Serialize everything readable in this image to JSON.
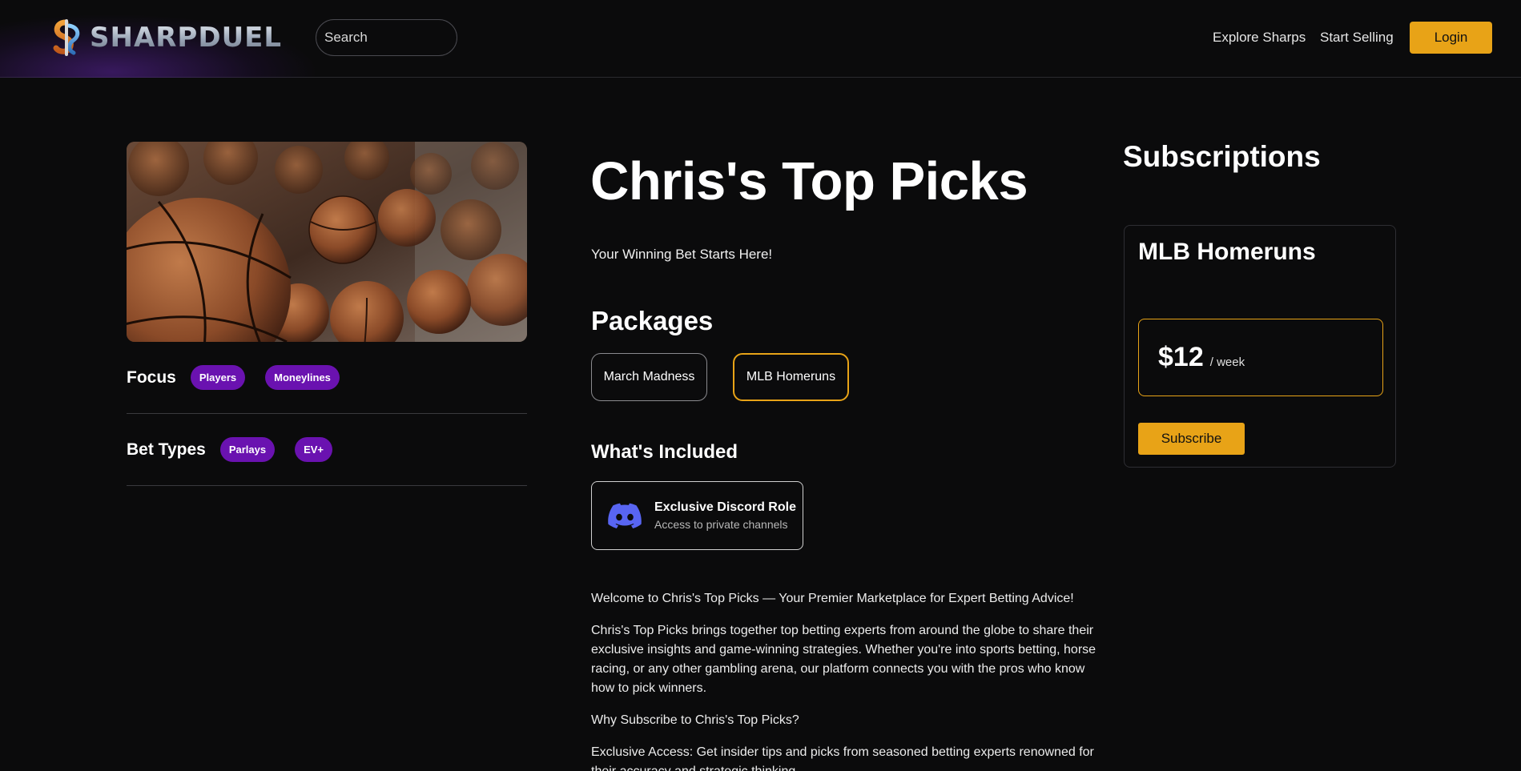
{
  "header": {
    "brand": "SHARPDUEL",
    "search_placeholder": "Search",
    "nav": {
      "explore": "Explore Sharps",
      "sell": "Start Selling"
    },
    "login_label": "Login",
    "accent_color": "#e8a317"
  },
  "profile": {
    "title": "Chris's Top Picks",
    "tagline": "Your Winning Bet Starts Here!",
    "hero_image": "basketballs-photo",
    "focus": {
      "label": "Focus",
      "tags": [
        "Players",
        "Moneylines"
      ]
    },
    "bet_types": {
      "label": "Bet Types",
      "tags": [
        "Parlays",
        "EV+"
      ]
    },
    "chip_color": "#6a12b0"
  },
  "packages": {
    "heading": "Packages",
    "items": [
      {
        "label": "March Madness",
        "selected": false
      },
      {
        "label": "MLB Homeruns",
        "selected": true
      }
    ]
  },
  "included": {
    "heading": "What's Included",
    "items": [
      {
        "icon": "discord-icon",
        "title": "Exclusive Discord Role",
        "subtitle": "Access to private channels",
        "icon_color": "#5865f2"
      }
    ]
  },
  "description": {
    "paragraphs": [
      "Welcome to Chris's Top Picks — Your Premier Marketplace for Expert Betting Advice!",
      "Chris's Top Picks brings together top betting experts from around the globe to share their exclusive insights and game-winning strategies. Whether you're into sports betting, horse racing, or any other gambling arena, our platform connects you with the pros who know how to pick winners.",
      "Why Subscribe to Chris's Top Picks?",
      "Exclusive Access: Get insider tips and picks from seasoned betting experts renowned for their accuracy and strategic thinking."
    ]
  },
  "subscriptions": {
    "heading": "Subscriptions",
    "card": {
      "title": "MLB Homeruns",
      "price": "$12",
      "period": "/ week",
      "button_label": "Subscribe"
    }
  }
}
